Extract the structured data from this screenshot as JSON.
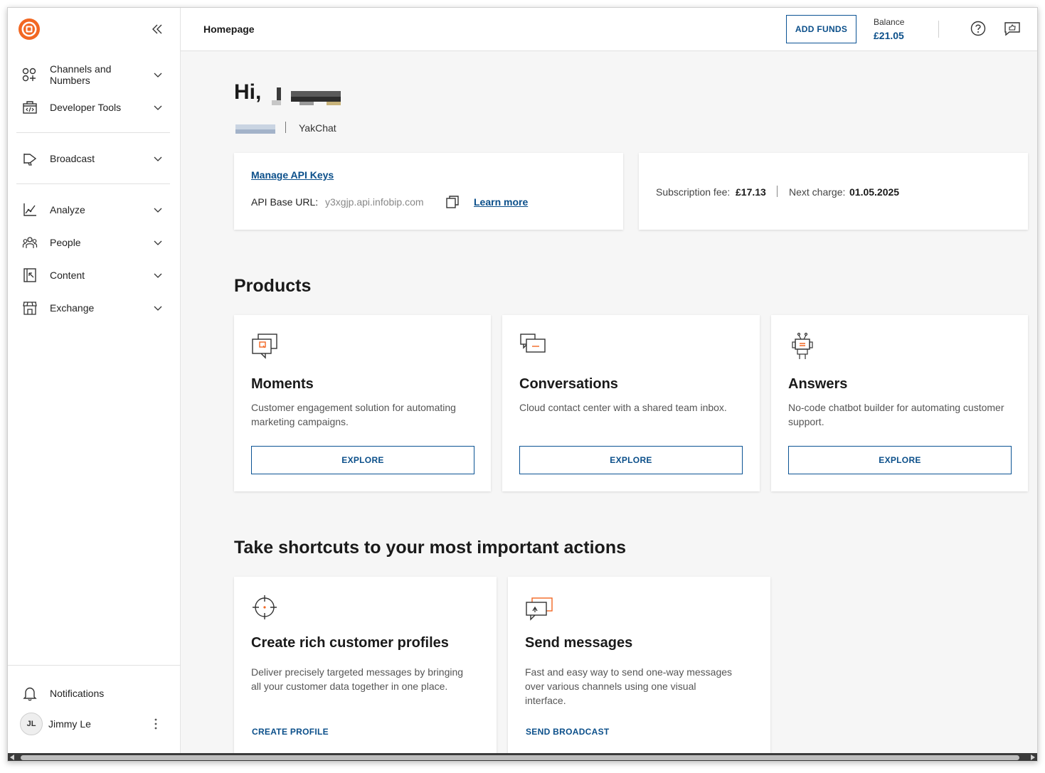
{
  "header": {
    "page_title": "Homepage",
    "add_funds_label": "ADD FUNDS",
    "balance_label": "Balance",
    "balance_value": "£21.05",
    "help_icon": "question-circle-icon",
    "feedback_icon": "feedback-icon"
  },
  "sidebar": {
    "logo": "infobip-logo",
    "collapse_icon": "double-chevron-left-icon",
    "items": [
      {
        "label": "Channels and Numbers",
        "icon": "channels-icon"
      },
      {
        "label": "Developer Tools",
        "icon": "code-icon"
      },
      {
        "label": "Broadcast",
        "icon": "megaphone-icon"
      },
      {
        "label": "Analyze",
        "icon": "chart-icon"
      },
      {
        "label": "People",
        "icon": "people-icon"
      },
      {
        "label": "Content",
        "icon": "content-icon"
      },
      {
        "label": "Exchange",
        "icon": "store-icon"
      }
    ],
    "notifications_label": "Notifications",
    "user": {
      "initials": "JL",
      "name": "Jimmy Le"
    }
  },
  "greeting": {
    "prefix": "Hi,",
    "account_name": "YakChat"
  },
  "api_card": {
    "manage_link": "Manage API Keys",
    "base_url_label": "API Base URL:",
    "base_url_value": "y3xgjp.api.infobip.com",
    "learn_more": "Learn more"
  },
  "billing_card": {
    "fee_label": "Subscription fee:",
    "fee_value": "£17.13",
    "next_label": "Next charge:",
    "next_value": "01.05.2025"
  },
  "products": {
    "heading": "Products",
    "items": [
      {
        "title": "Moments",
        "description": "Customer engagement solution for automating marketing campaigns.",
        "button": "EXPLORE",
        "icon": "moments-icon"
      },
      {
        "title": "Conversations",
        "description": "Cloud contact center with a shared team inbox.",
        "button": "EXPLORE",
        "icon": "conversations-icon"
      },
      {
        "title": "Answers",
        "description": "No-code chatbot builder for automating customer support.",
        "button": "EXPLORE",
        "icon": "robot-icon"
      }
    ]
  },
  "shortcuts": {
    "heading": "Take shortcuts to your most important actions",
    "items": [
      {
        "title": "Create rich customer profiles",
        "description": "Deliver precisely targeted messages by bringing all your customer data together in one place.",
        "link": "CREATE PROFILE",
        "icon": "target-icon"
      },
      {
        "title": "Send messages",
        "description": "Fast and easy way to send one-way messages over various channels using one visual interface.",
        "link": "SEND BROADCAST",
        "icon": "send-message-icon"
      }
    ]
  },
  "colors": {
    "accent": "#0b4f8a",
    "brand": "#f26722"
  }
}
